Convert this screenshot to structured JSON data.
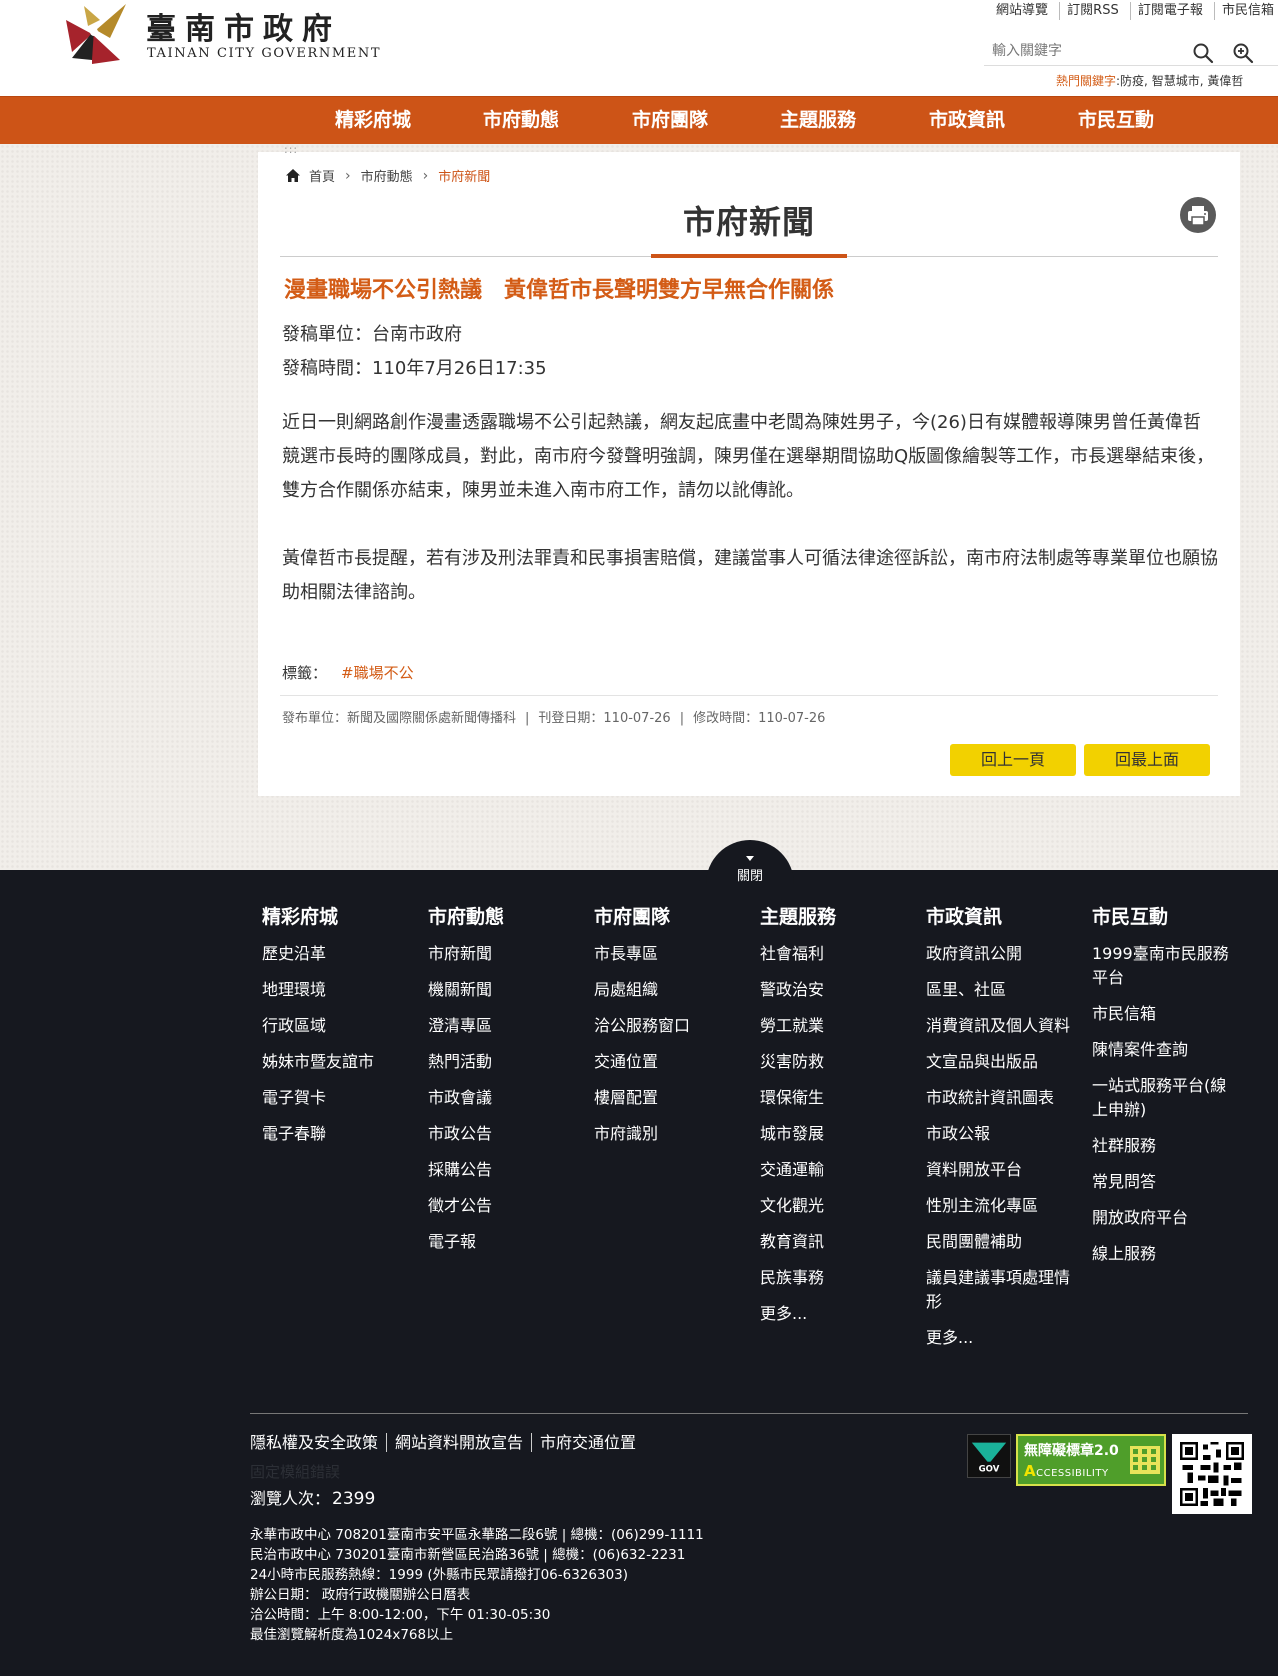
{
  "header": {
    "logo_zh": "臺南市政府",
    "logo_en": "TAINAN CITY GOVERNMENT",
    "top_links": [
      "網站導覽",
      "訂閱RSS",
      "訂閱電子報",
      "市民信箱"
    ],
    "search_placeholder": "輸入關鍵字",
    "hot_keywords_label": "熱門關鍵字",
    "hot_keywords": ":防疫, 智慧城市, 黃偉哲"
  },
  "nav": {
    "items": [
      "精彩府城",
      "市府動態",
      "市府團隊",
      "主題服務",
      "市政資訊",
      "市民互動"
    ]
  },
  "breadcrumb": {
    "dots": ":::",
    "items": [
      "首頁",
      "市府動態"
    ],
    "current": "市府新聞"
  },
  "article": {
    "section_title": "市府新聞",
    "headline": "漫畫職場不公引熱議　黃偉哲市長聲明雙方早無合作關係",
    "publisher": "發稿單位：台南市政府",
    "time": "發稿時間：110年7月26日17:35",
    "paragraphs": [
      "近日一則網路創作漫畫透露職場不公引起熱議，網友起底畫中老闆為陳姓男子，今(26)日有媒體報導陳男曾任黃偉哲競選市長時的團隊成員，對此，南市府今發聲明強調，陳男僅在選舉期間協助Q版圖像繪製等工作，市長選舉結束後，雙方合作關係亦結束，陳男並未進入南市府工作，請勿以訛傳訛。",
      "黃偉哲市長提醒，若有涉及刑法罪責和民事損害賠償，建議當事人可循法律途徑訴訟，南市府法制處等專業單位也願協助相關法律諮詢。"
    ],
    "tags_label": "標籤：",
    "tag": "#職場不公",
    "pub_unit": "發布單位：新聞及國際關係處新聞傳播科",
    "pub_date": "刊登日期：110-07-26",
    "mod_date": "修改時間：110-07-26",
    "back_label": "回上一頁",
    "top_label": "回最上面"
  },
  "footer": {
    "close_label": "關閉",
    "columns": [
      {
        "title": "精彩府城",
        "items": [
          "歷史沿革",
          "地理環境",
          "行政區域",
          "姊妹市暨友誼市",
          "電子賀卡",
          "電子春聯"
        ]
      },
      {
        "title": "市府動態",
        "items": [
          "市府新聞",
          "機關新聞",
          "澄清專區",
          "熱門活動",
          "市政會議",
          "市政公告",
          "採購公告",
          "徵才公告",
          "電子報"
        ]
      },
      {
        "title": "市府團隊",
        "items": [
          "市長專區",
          "局處組織",
          "洽公服務窗口",
          "交通位置",
          "樓層配置",
          "市府識別"
        ]
      },
      {
        "title": "主題服務",
        "items": [
          "社會福利",
          "警政治安",
          "勞工就業",
          "災害防救",
          "環保衛生",
          "城市發展",
          "交通運輸",
          "文化觀光",
          "教育資訊",
          "民族事務",
          "更多..."
        ]
      },
      {
        "title": "市政資訊",
        "items": [
          "政府資訊公開",
          "區里、社區",
          "消費資訊及個人資料",
          "文宣品與出版品",
          "市政統計資訊圖表",
          "市政公報",
          "資料開放平台",
          "性別主流化專區",
          "民間團體補助",
          "議員建議事項處理情形",
          "更多..."
        ]
      },
      {
        "title": "市民互動",
        "items": [
          "1999臺南市民服務平台",
          "市民信箱",
          "陳情案件查詢",
          "一站式服務平台(線上申辦)",
          "社群服務",
          "常見問答",
          "開放政府平台",
          "線上服務"
        ]
      }
    ],
    "links": [
      "隱私權及安全政策",
      "網站資料開放宣告",
      "市府交通位置"
    ],
    "ghost_text": "固定模組錯誤",
    "visitor_label": "瀏覽人次：",
    "visitor_count": "2399",
    "address_lines": [
      "永華市政中心 708201臺南市安平區永華路二段6號 | 總機：(06)299-1111",
      "民治市政中心 730201臺南市新營區民治路36號 | 總機：(06)632-2231",
      "24小時市民服務熱線：1999 (外縣市民眾請撥打06-6326303)",
      "辦公日期：  政府行政機關辦公日曆表",
      "洽公時間：上午 8:00-12:00，下午 01:30-05:30",
      "最佳瀏覽解析度為1024x768以上"
    ],
    "badge_gov": "GOV",
    "badge_acc_title": "無障礙標章2.0",
    "badge_acc_sub": "CCESSIBILITY",
    "badge_acc_letter": "A"
  },
  "colors": {
    "brand_orange": "#cd5417",
    "headline_orange": "#d35c16",
    "button_yellow": "#f2d100",
    "footer_bg": "#16181f"
  }
}
